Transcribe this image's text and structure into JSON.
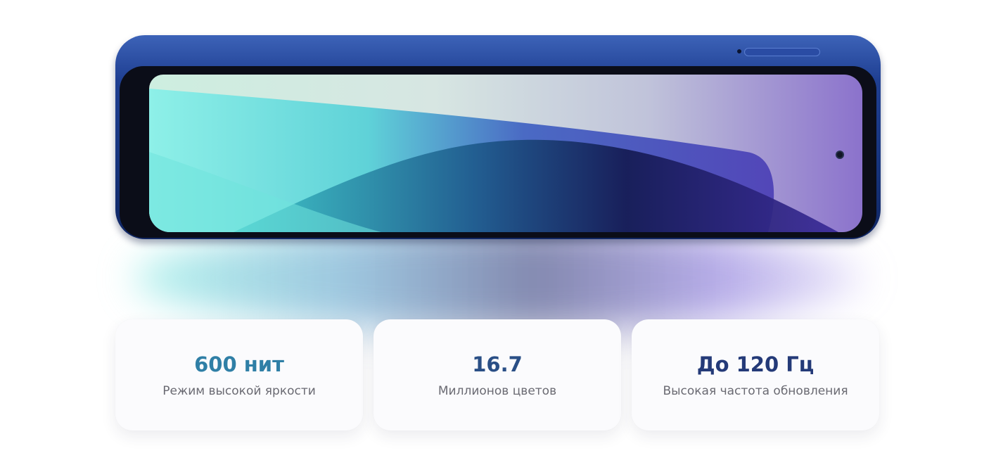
{
  "hero": {
    "colors": {
      "phone_frame": "#1f3f92",
      "screen_teal": "#5fe0d6",
      "screen_navy": "#1a1b5a",
      "screen_purple": "#7a5ccf"
    }
  },
  "stats": [
    {
      "value": "600 нит",
      "label": "Режим высокой яркости",
      "value_color": "#2f7fa6"
    },
    {
      "value": "16.7",
      "label": "Миллионов цветов",
      "value_color": "#2a4f86"
    },
    {
      "value": "До 120 Гц",
      "label": "Высокая частота обновления",
      "value_color": "#243a78"
    }
  ]
}
